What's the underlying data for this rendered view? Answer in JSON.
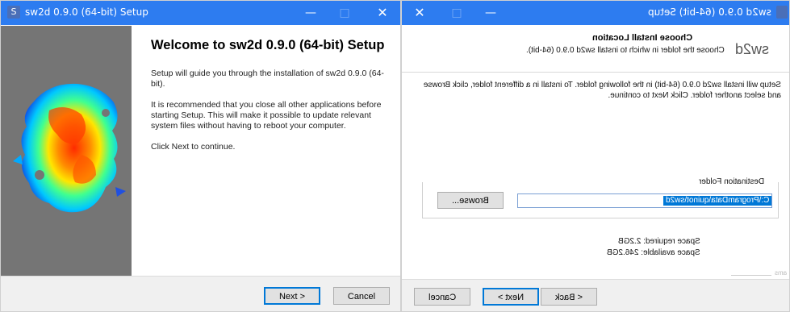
{
  "window1": {
    "title": "sw2d 0.9.0 (64-bit) Setup",
    "app_icon": "S",
    "controls": {
      "minimize": "—",
      "maximize": "□",
      "close": "✕"
    },
    "heading": "Welcome to sw2d 0.9.0 (64-bit) Setup",
    "paragraphs": [
      "Setup will guide you through the installation of sw2d 0.9.0 (64-bit).",
      "It is recommended that you close all other applications before starting Setup. This will make it possible to update relevant system files without having to reboot your computer.",
      "Click Next to continue."
    ],
    "buttons": {
      "next": "Next >",
      "cancel": "Cancel"
    }
  },
  "window2": {
    "title": "sw2d 0.9.0 (64-bit) Setup",
    "controls": {
      "close": "✕",
      "maximize": "□",
      "minimize": "—"
    },
    "logo": "sw2d",
    "header_title": "Choose Install Location",
    "header_subtitle": "Choose the folder in which to install sw2d 0.9.0 (64-bit).",
    "body": "Setup will install sw2d 0.9.0 (64-bit) in the following folder. To install in a different folder, click Browse and select another folder. Click Next to continue.",
    "destination_label": "Destination Folder",
    "destination_path": "C:\\ProgramData\\quinot\\sw2d",
    "browse_label": "Browse...",
    "space_required": "Space required: 2.2GB",
    "space_available": "Space available: 246.2GB",
    "branding": "ams",
    "buttons": {
      "back": "< Back",
      "next": "Next >",
      "cancel": "Cancel"
    }
  },
  "colors": {
    "titlebar": "#2d7cf0",
    "sidebar": "#757575",
    "selection": "#0078d7"
  }
}
